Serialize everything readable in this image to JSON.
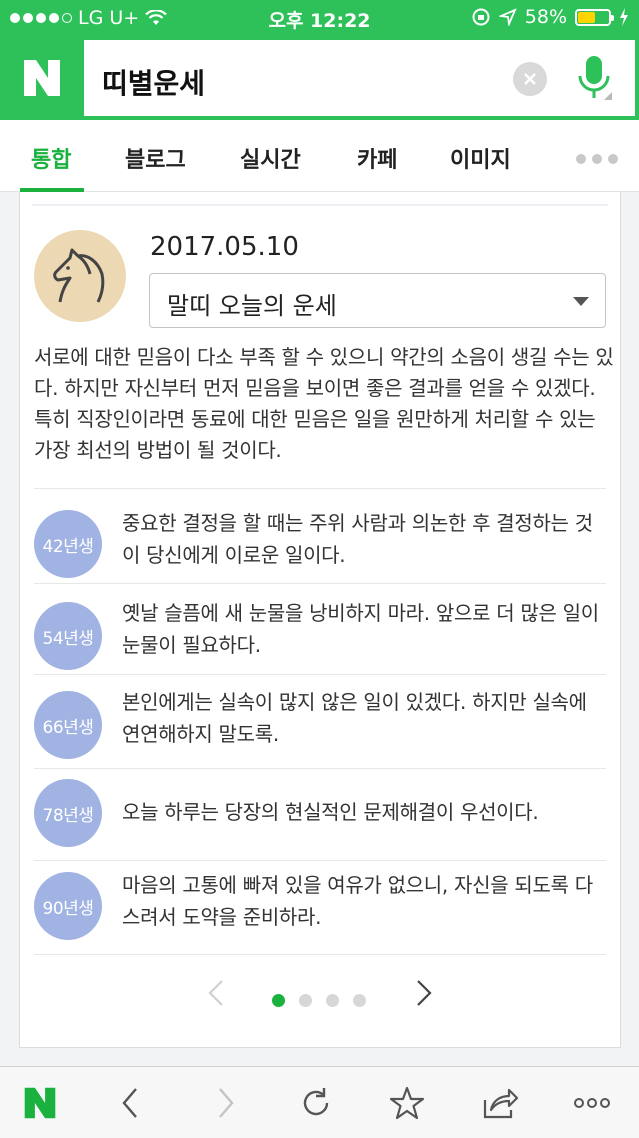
{
  "status_bar": {
    "carrier": "LG U+",
    "time": "오후 12:22",
    "battery_percent": "58%",
    "battery_level": 0.58
  },
  "search": {
    "logo": "N",
    "query": "띠별운세",
    "clear_icon": "close-icon",
    "mic_icon": "microphone-icon"
  },
  "tabs": [
    {
      "label": "통합",
      "active": true
    },
    {
      "label": "블로그",
      "active": false
    },
    {
      "label": "실시간",
      "active": false
    },
    {
      "label": "카페",
      "active": false
    },
    {
      "label": "이미지",
      "active": false
    }
  ],
  "fortune_card": {
    "date": "2017.05.10",
    "zodiac_icon": "horse-icon",
    "selected_option": "말띠 오늘의 운세",
    "summary": "서로에 대한 믿음이 다소 부족 할 수 있으니 약간의 소음이 생길 수는 있다. 하지만 자신부터 먼저 믿음을 보이면 좋은 결과를 얻을 수 있겠다. 특히 직장인이라면 동료에 대한 믿음은 일을 원만하게 처리할 수 있는 가장 최선의 방법이 될 것이다.",
    "years": [
      {
        "badge": "42년생",
        "text": "중요한 결정을 할 때는 주위 사람과 의논한 후 결정하는 것이 당신에게 이로운 일이다."
      },
      {
        "badge": "54년생",
        "text": "옛날 슬픔에 새 눈물을 낭비하지 마라. 앞으로 더 많은 일이 눈물이 필요하다."
      },
      {
        "badge": "66년생",
        "text": "본인에게는 실속이 많지 않은 일이 있겠다. 하지만 실속에 연연해하지 말도록."
      },
      {
        "badge": "78년생",
        "text": "오늘 하루는 당장의 현실적인 문제해결이 우선이다."
      },
      {
        "badge": "90년생",
        "text": "마음의 고통에 빠져 있을 여유가 없으니, 자신을 되도록 다스려서 도약을 준비하라."
      }
    ],
    "pager": {
      "current_page": 1,
      "total_pages": 4
    }
  },
  "toolbar": {
    "home_logo": "N",
    "items": [
      "back-icon",
      "forward-icon",
      "refresh-icon",
      "bookmark-star-icon",
      "share-icon",
      "more-icon"
    ]
  },
  "colors": {
    "brand_green": "#2ec15a",
    "active_tab": "#1ab13f",
    "year_badge": "#a0b3e2",
    "avatar_bg": "#ecd8b3"
  }
}
